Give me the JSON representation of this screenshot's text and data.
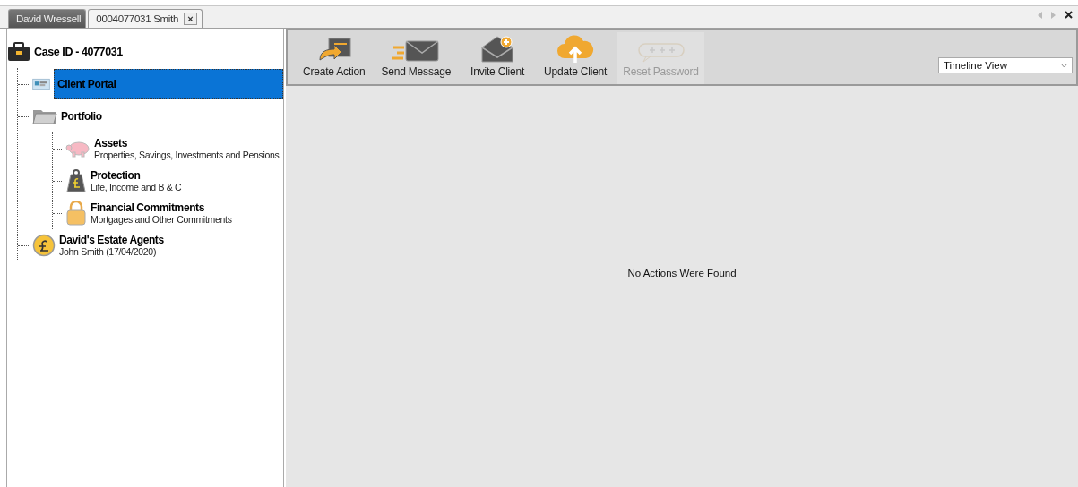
{
  "tabs": [
    {
      "label": "David Wressell",
      "selected": true,
      "closable": false
    },
    {
      "label": "0004077031 Smith",
      "selected": false,
      "closable": true
    }
  ],
  "tab_close": "×",
  "tree": {
    "label": "Case ID - 4077031",
    "kind": "case",
    "selected": false,
    "children": [
      {
        "label": "Client Portal",
        "kind": "portal",
        "selected": true
      },
      {
        "label": "Portfolio",
        "kind": "folder",
        "selected": false,
        "children": [
          {
            "label": "Assets",
            "subtitle": "Properties, Savings, Investments and Pensions",
            "kind": "piggy",
            "selected": false
          },
          {
            "label": "Protection",
            "subtitle": "Life, Income and B & C",
            "kind": "weight",
            "selected": false
          },
          {
            "label": "Financial Commitments",
            "subtitle": "Mortgages and Other Commitments",
            "kind": "lock",
            "selected": false
          }
        ]
      },
      {
        "label": "David's Estate Agents",
        "subtitle": "John Smith (17/04/2020)",
        "kind": "coin",
        "selected": false
      }
    ]
  },
  "toolbar": [
    {
      "label": "Create Action",
      "kind": "create",
      "disabled": false
    },
    {
      "label": "Send Message",
      "kind": "send",
      "disabled": false
    },
    {
      "label": "Invite Client",
      "kind": "invite",
      "disabled": false
    },
    {
      "label": "Update Client",
      "kind": "update",
      "disabled": false
    },
    {
      "label": "Reset Password",
      "kind": "reset",
      "disabled": true
    }
  ],
  "view_select": {
    "value": "Timeline View"
  },
  "empty_message": "No Actions Were Found"
}
